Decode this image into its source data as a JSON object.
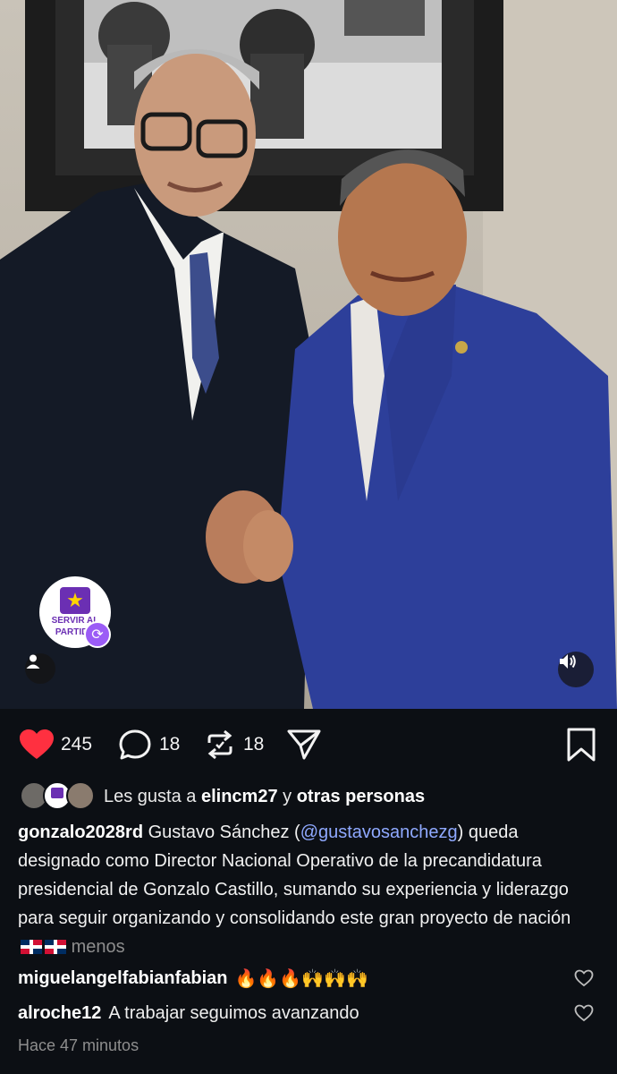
{
  "post": {
    "badge_text_line1": "SERVIR AL",
    "badge_text_line2": "PARTIDO",
    "badge_star": "★",
    "repost_glyph": "⟳"
  },
  "actions": {
    "likes_count": "245",
    "comments_count": "18",
    "reposts_count": "18"
  },
  "likes": {
    "prefix": "Les gusta a ",
    "user": "elincm27",
    "connector": " y ",
    "others": "otras personas"
  },
  "caption": {
    "user": "gonzalo2028rd",
    "text_before": " Gustavo Sánchez (",
    "mention": "@gustavosanchezg",
    "text_after": ") queda designado como Director Nacional Operativo de la precandidatura presidencial de Gonzalo Castillo, sumando su experiencia y liderazgo para seguir organizando y consolidando este gran proyecto de nación ",
    "more": "menos"
  },
  "comments": [
    {
      "user": "miguelangelfabianfabian",
      "text": "🔥🔥🔥🙌🙌🙌"
    },
    {
      "user": "alroche12",
      "text": "A trabajar seguimos avanzando"
    }
  ],
  "timestamp": "Hace 47 minutos",
  "colors": {
    "like_red": "#ff3040",
    "mention_blue": "#8fa9ff",
    "background": "#0c0f14",
    "badge_purple": "#6b2fb3"
  }
}
